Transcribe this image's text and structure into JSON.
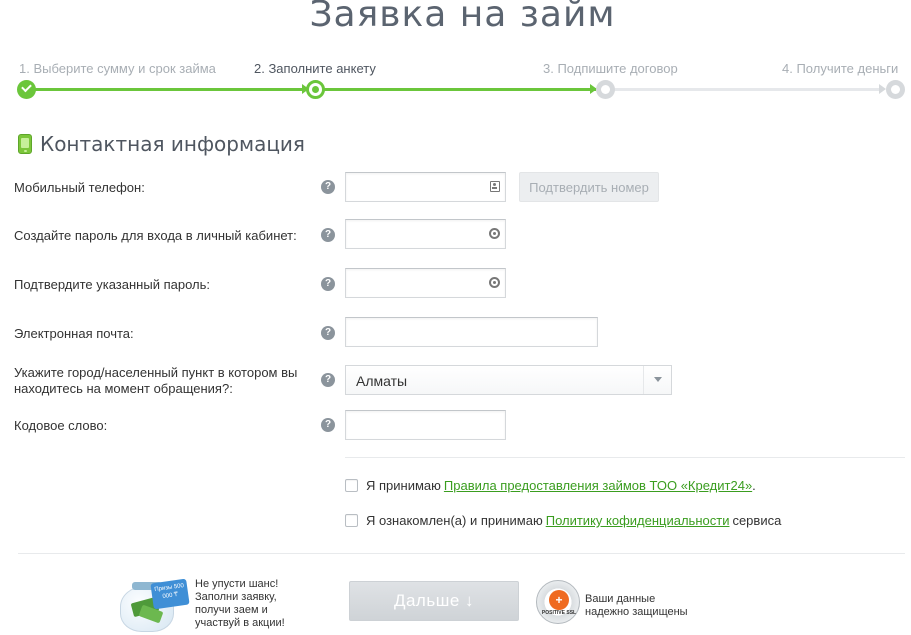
{
  "page": {
    "title": "Заявка на займ"
  },
  "steps": [
    {
      "label": "1. Выберите сумму и срок займа",
      "state": "done"
    },
    {
      "label": "2. Заполните анкету",
      "state": "current"
    },
    {
      "label": "3. Подпишите договор",
      "state": "todo"
    },
    {
      "label": "4. Получите деньги",
      "state": "todo"
    }
  ],
  "section": {
    "title": "Контактная информация",
    "icon": "mobile-phone-icon"
  },
  "form": {
    "phone": {
      "label": "Мобильный телефон:",
      "value": "",
      "icon": "contact-card-icon"
    },
    "confirm_button": "Подтвердить номер",
    "password": {
      "label": "Создайте пароль для входа в личный кабинет:",
      "value": "",
      "icon": "key-icon"
    },
    "password_confirm": {
      "label": "Подтвердите указанный пароль:",
      "value": "",
      "icon": "key-icon"
    },
    "email": {
      "label": "Электронная почта:",
      "value": ""
    },
    "city": {
      "label": "Укажите город/населенный пункт в котором вы находитесь на момент обращения?:",
      "value": "Алматы"
    },
    "codeword": {
      "label": "Кодовое слово:",
      "value": ""
    },
    "help_glyph": "?"
  },
  "agreements": {
    "rules": {
      "prefix": "Я принимаю",
      "link": "Правила предоставления займов ТОО «Кредит24»",
      "suffix": "."
    },
    "privacy": {
      "prefix": "Я ознакомлен(а) и принимаю",
      "link": "Политику кофиденциальности",
      "suffix": "сервиса"
    }
  },
  "footer": {
    "promo_lines": [
      "Не упусти шанс!",
      "Заполни заявку,",
      "получи заем и",
      "участвуй в акции!"
    ],
    "promo_tag": "Призы 500 000 ₸",
    "next_button": "Дальше ↓",
    "ssl_badge": "POSITIVE SSL",
    "ssl_lines": [
      "Ваши данные",
      "надежно защищены"
    ]
  },
  "colors": {
    "accent": "#6bc63b",
    "link": "#3a9d1f",
    "muted": "#a8aeb4"
  }
}
